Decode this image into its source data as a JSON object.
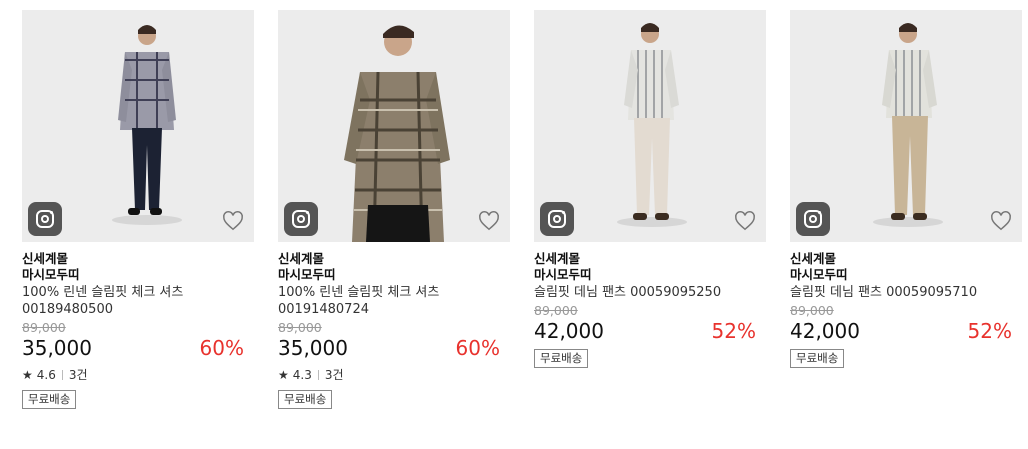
{
  "products": [
    {
      "brand": "신세계몰",
      "shop": "마시모두띠",
      "name": "100% 린넨 슬림핏 체크 셔츠 00189480500",
      "original_price": "89,000",
      "price": "35,000",
      "discount": "60%",
      "rating": "4.6",
      "reviews": "3건",
      "badge": "무료배송"
    },
    {
      "brand": "신세계몰",
      "shop": "마시모두띠",
      "name": "100% 린넨 슬림핏 체크 셔츠 00191480724",
      "original_price": "89,000",
      "price": "35,000",
      "discount": "60%",
      "rating": "4.3",
      "reviews": "3건",
      "badge": "무료배송"
    },
    {
      "brand": "신세계몰",
      "shop": "마시모두띠",
      "name": "슬림핏 데님 팬츠 00059095250",
      "original_price": "89,000",
      "price": "42,000",
      "discount": "52%",
      "badge": "무료배송"
    },
    {
      "brand": "신세계몰",
      "shop": "마시모두띠",
      "name": "슬림핏 데님 팬츠 00059095710",
      "original_price": "89,000",
      "price": "42,000",
      "discount": "52%",
      "badge": "무료배송"
    }
  ],
  "colors": {
    "discount": "#e8322d",
    "icon_bg": "#555555"
  },
  "icons": {
    "camera": "instagram-camera-icon",
    "wishlist": "heart-outline-icon",
    "rating": "star-icon"
  }
}
